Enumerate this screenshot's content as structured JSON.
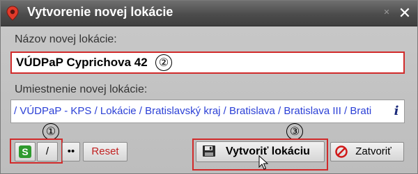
{
  "window": {
    "title": "Vytvorenie novej lokácie",
    "close_glyph": "✕",
    "pin_glyph": "✕"
  },
  "form": {
    "name_label": "Názov novej lokácie:",
    "name_value": "VÚDPaP Cyprichova 42",
    "location_label": "Umiestnenie novej lokácie:",
    "location_path": "/ VÚDPaP - KPS / Lokácie / Bratislavský kraj / Bratislava / Bratislava III / Brati",
    "info_glyph": "i"
  },
  "annotations": {
    "marker_1": "①",
    "marker_2": "②",
    "marker_3": "③"
  },
  "buttons": {
    "s_label": "S",
    "slash_label": "/",
    "dots_label": "••",
    "reset_label": "Reset",
    "create_label": "Vytvoriť lokáciu",
    "close_label": "Zatvoriť"
  },
  "colors": {
    "titlebar": "#4c4c4c",
    "highlight_red": "#d12a2a",
    "path_link": "#2a3fd6",
    "s_green": "#2e9a2e"
  }
}
